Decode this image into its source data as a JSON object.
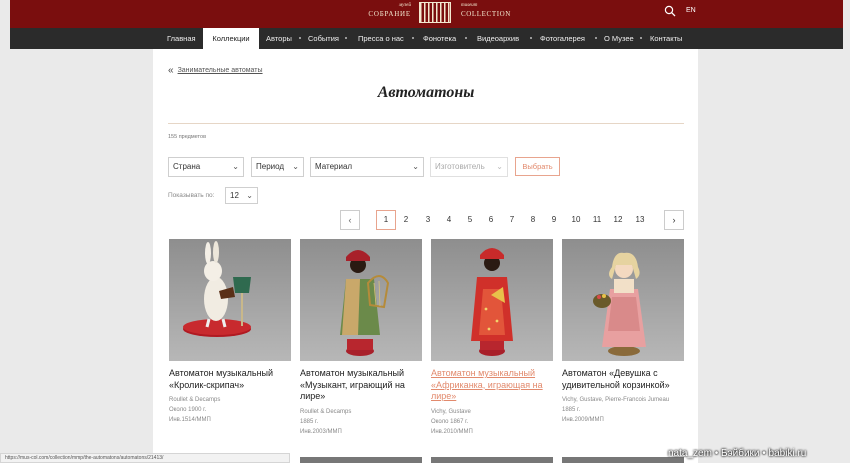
{
  "header": {
    "logo_left_small": "музей",
    "logo_left_big": "СОБРАНИЕ",
    "logo_right_small": "museum",
    "logo_right_big": "COLLECTION",
    "lang": "EN"
  },
  "nav": {
    "items": [
      "Главная",
      "Коллекции",
      "Авторы",
      "События",
      "Пресса о нас",
      "Фонотека",
      "Видеоархив",
      "Фотогалерея",
      "О Музее",
      "Контакты"
    ],
    "active": "Коллекции"
  },
  "breadcrumb": {
    "back_label": "Занимательные автоматы"
  },
  "page": {
    "title": "Автоматоны",
    "count": "155 предметов"
  },
  "filters": {
    "country": "Страна",
    "period": "Период",
    "material": "Материал",
    "maker": "Изготовитель",
    "choose_button": "Выбрать",
    "per_page_label": "Показывать по:",
    "per_page_value": "12"
  },
  "pagination": {
    "prev": "‹",
    "next": "›",
    "pages": [
      "1",
      "2",
      "3",
      "4",
      "5",
      "6",
      "7",
      "8",
      "9",
      "10",
      "11",
      "12",
      "13"
    ],
    "current": "1"
  },
  "items": [
    {
      "title": "Автоматон музыкальный «Кролик-скрипач»",
      "maker": "Roullet & Decamps",
      "date": "Около 1900 г.",
      "inv": "Инв.1514/ММП"
    },
    {
      "title": "Автоматон музыкальный «Музыкант, играющий на лире»",
      "maker": "Roullet & Decamps",
      "date": "1885 г.",
      "inv": "Инв.2003/ММП"
    },
    {
      "title": "Автоматон музыкальный «Африканка, играющая на лире»",
      "maker": "Vichy, Gustave",
      "date": "Около 1867 г.",
      "inv": "Инв.2010/ММП"
    },
    {
      "title": "Автоматон «Девушка с удивительной корзинкой»",
      "maker": "Vichy, Gustave, Pierre-Francois Jumeau",
      "date": "1885 г.",
      "inv": "Инв.2009/ММП"
    }
  ],
  "status_url": "https://mus-col.com/collection/mmp/the-automatons/automatons/21413/",
  "watermark": "nata_zem • Бэйбики • babiki.ru",
  "colors": {
    "header": "#7a0e0e",
    "nav": "#2b2b2b",
    "accent": "#e28a6d"
  }
}
